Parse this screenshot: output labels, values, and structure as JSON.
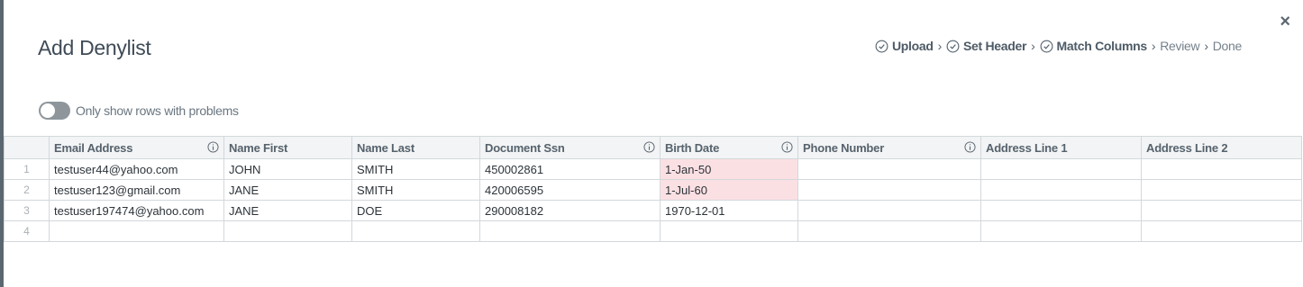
{
  "modal": {
    "title": "Add Denylist",
    "close_label": "×"
  },
  "steps": [
    {
      "label": "Upload",
      "status": "done"
    },
    {
      "label": "Set Header",
      "status": "done"
    },
    {
      "label": "Match Columns",
      "status": "done"
    },
    {
      "label": "Review",
      "status": "todo"
    },
    {
      "label": "Done",
      "status": "todo"
    }
  ],
  "step_separator": "›",
  "filter": {
    "label": "Only show rows with problems",
    "enabled": false
  },
  "table": {
    "columns": [
      {
        "label": "Email Address",
        "info": true
      },
      {
        "label": "Name First",
        "info": false
      },
      {
        "label": "Name Last",
        "info": false
      },
      {
        "label": "Document Ssn",
        "info": true
      },
      {
        "label": "Birth Date",
        "info": true
      },
      {
        "label": "Phone Number",
        "info": true
      },
      {
        "label": "Address Line 1",
        "info": false
      },
      {
        "label": "Address Line 2",
        "info": false
      }
    ],
    "rows": [
      {
        "num": "1",
        "cells": [
          "testuser44@yahoo.com",
          "JOHN",
          "SMITH",
          "450002861",
          "1-Jan-50",
          "",
          "",
          ""
        ],
        "errors": [
          4
        ]
      },
      {
        "num": "2",
        "cells": [
          "testuser123@gmail.com",
          "JANE",
          "SMITH",
          "420006595",
          "1-Jul-60",
          "",
          "",
          ""
        ],
        "errors": [
          4
        ]
      },
      {
        "num": "3",
        "cells": [
          "testuser197474@yahoo.com",
          "JANE",
          "DOE",
          "290008182",
          "1970-12-01",
          "",
          "",
          ""
        ],
        "errors": []
      },
      {
        "num": "4",
        "cells": [
          "",
          "",
          "",
          "",
          "",
          "",
          "",
          ""
        ],
        "errors": []
      }
    ]
  },
  "colors": {
    "error_cell": "#fbe0e3",
    "header_bg": "#f2f4f5",
    "toggle_off": "#8e969c"
  }
}
